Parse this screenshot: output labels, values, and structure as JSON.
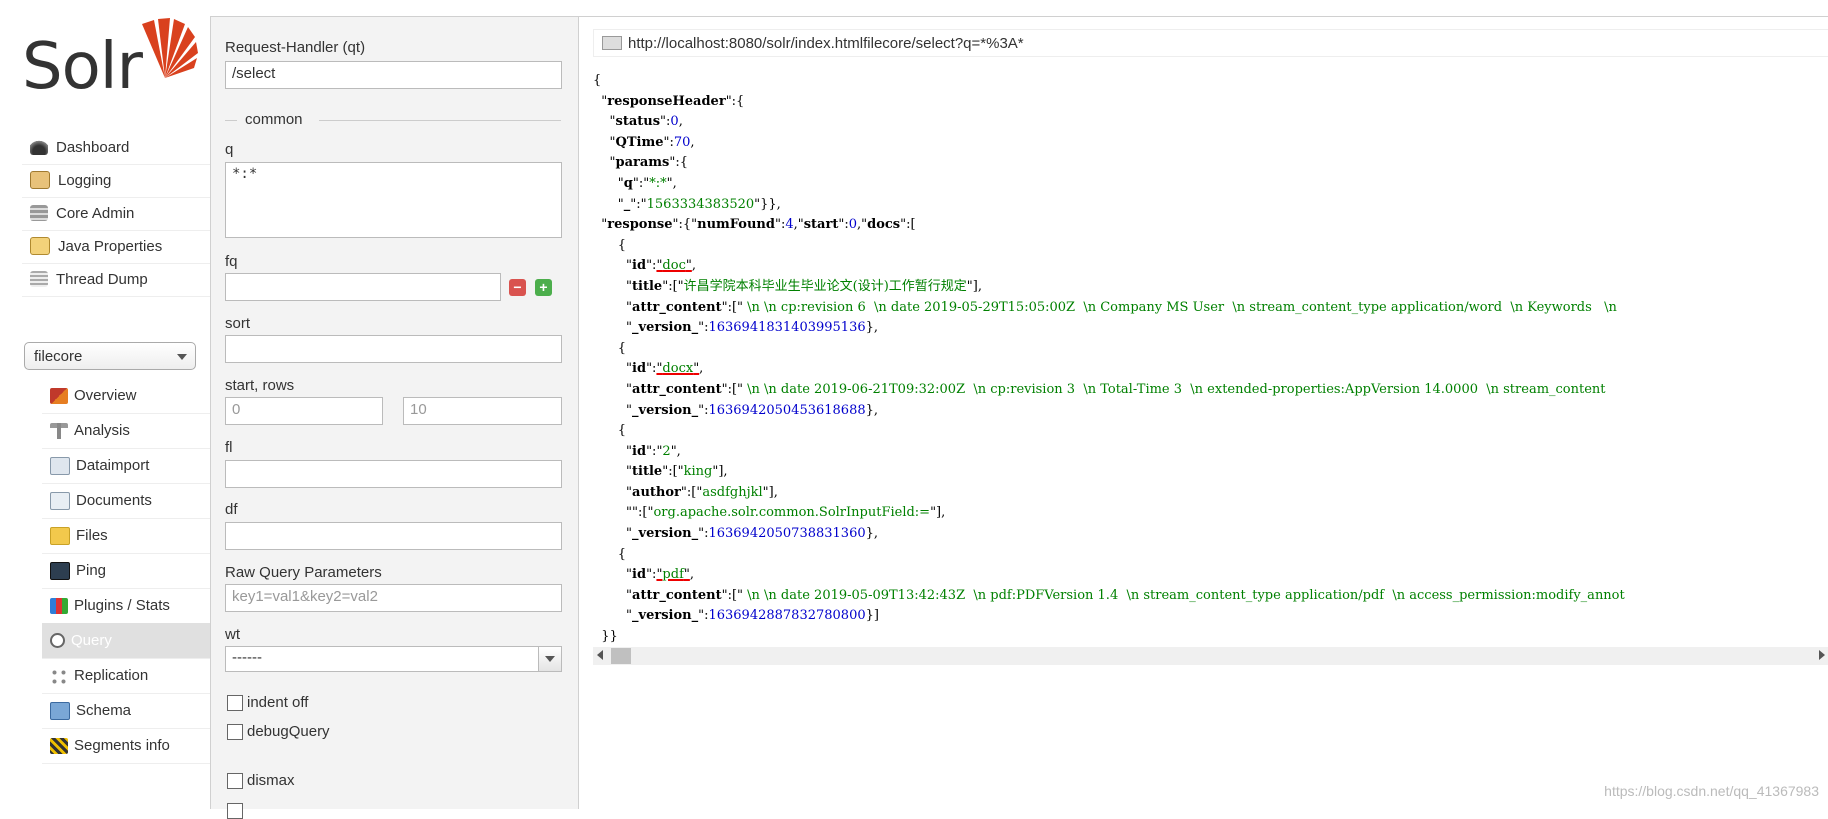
{
  "brand": {
    "logo_text": "Solr",
    "accent": "#d9411e"
  },
  "sidebar": {
    "main": [
      {
        "label": "Dashboard",
        "icon": "dashboard-icon"
      },
      {
        "label": "Logging",
        "icon": "logging-icon"
      },
      {
        "label": "Core Admin",
        "icon": "core-admin-icon"
      },
      {
        "label": "Java Properties",
        "icon": "java-icon"
      },
      {
        "label": "Thread Dump",
        "icon": "thread-dump-icon"
      }
    ],
    "core_selected": "filecore",
    "core_items": [
      {
        "label": "Overview",
        "icon": "home-icon"
      },
      {
        "label": "Analysis",
        "icon": "funnel-icon"
      },
      {
        "label": "Dataimport",
        "icon": "dataimport-icon"
      },
      {
        "label": "Documents",
        "icon": "documents-icon"
      },
      {
        "label": "Files",
        "icon": "folder-icon"
      },
      {
        "label": "Ping",
        "icon": "ping-icon"
      },
      {
        "label": "Plugins / Stats",
        "icon": "plugins-icon"
      },
      {
        "label": "Query",
        "icon": "search-icon",
        "active": true
      },
      {
        "label": "Replication",
        "icon": "replication-icon"
      },
      {
        "label": "Schema",
        "icon": "schema-icon"
      },
      {
        "label": "Segments info",
        "icon": "segments-icon"
      }
    ]
  },
  "form": {
    "qt_label": "Request-Handler (qt)",
    "qt_value": "/select",
    "common_legend": "common",
    "q_label": "q",
    "q_value": "*:*",
    "fq_label": "fq",
    "fq_value": "",
    "sort_label": "sort",
    "sort_value": "",
    "start_rows_label": "start, rows",
    "start_placeholder": "0",
    "rows_placeholder": "10",
    "fl_label": "fl",
    "fl_value": "",
    "df_label": "df",
    "df_value": "",
    "raw_label": "Raw Query Parameters",
    "raw_placeholder": "key1=val1&key2=val2",
    "wt_label": "wt",
    "wt_value": "------",
    "indent_label": "indent off",
    "debug_label": "debugQuery",
    "dismax_label": "dismax"
  },
  "result": {
    "url": "http://localhost:8080/solr/index.htmlfilecore/select?q=*%3A*",
    "response": {
      "status": 0,
      "QTime": 70,
      "params_q": "*:*",
      "params_underscore": "1563334383520",
      "numFound": 4,
      "start": 0,
      "docs": [
        {
          "id": "doc",
          "title": "许昌学院本科毕业生毕业论文(设计)工作暂行规定",
          "attr_content": " \\n \\n cp:revision 6  \\n date 2019-05-29T15:05:00Z  \\n Company MS User  \\n stream_content_type application/word  \\n Keywords   \\n",
          "version": "1636941831403995136"
        },
        {
          "id": "docx",
          "attr_content": " \\n \\n date 2019-06-21T09:32:00Z  \\n cp:revision 3  \\n Total-Time 3  \\n extended-properties:AppVersion 14.0000  \\n stream_content",
          "version": "1636942050453618688"
        },
        {
          "id": "2",
          "title": "king",
          "author": "asdfghjkl",
          "empty_key_value": "org.apache.solr.common.SolrInputField:=",
          "version": "1636942050738831360"
        },
        {
          "id": "pdf",
          "attr_content": " \\n \\n date 2019-05-09T13:42:43Z  \\n pdf:PDFVersion 1.4  \\n stream_content_type application/pdf  \\n access_permission:modify_annot",
          "version": "1636942887832780800"
        }
      ]
    }
  },
  "watermark": "https://blog.csdn.net/qq_41367983"
}
